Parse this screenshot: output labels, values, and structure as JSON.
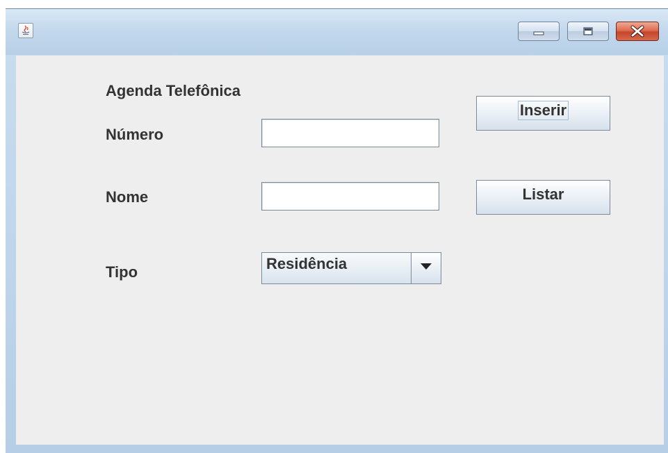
{
  "window": {
    "title": "",
    "controls": {
      "minimize": "minimize-icon",
      "maximize": "maximize-icon",
      "close": "close-icon"
    },
    "app_icon": "java-cup-icon"
  },
  "form": {
    "heading": "Agenda Telefônica",
    "numero_label": "Número",
    "numero_value": "",
    "nome_label": "Nome",
    "nome_value": "",
    "tipo_label": "Tipo",
    "tipo_selected": "Residência",
    "inserir_label": "Inserir",
    "listar_label": "Listar"
  },
  "colors": {
    "content_bg": "#eeeeee",
    "title_bar": "#c3d8ec",
    "close_button": "#c5452a"
  }
}
